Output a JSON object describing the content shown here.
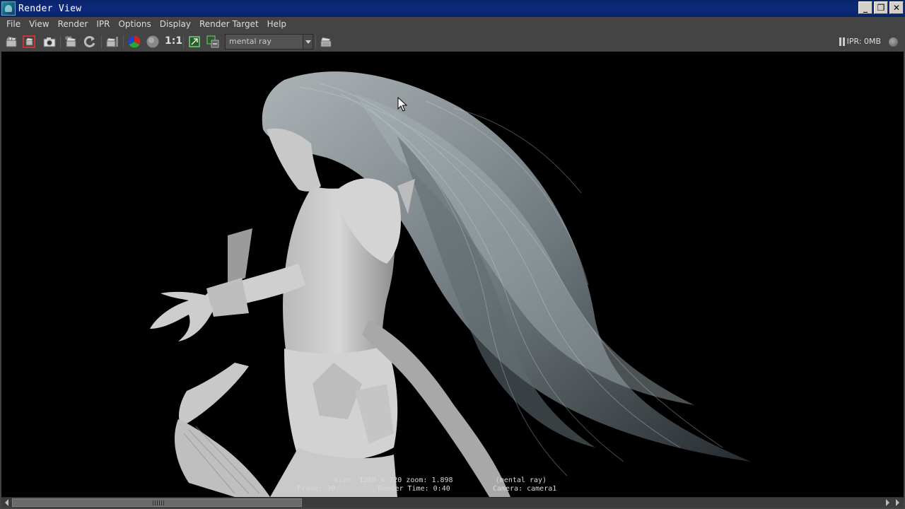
{
  "window": {
    "title": "Render View",
    "minimize": "_",
    "restore": "❐",
    "close": "✕"
  },
  "menu": [
    "File",
    "View",
    "Render",
    "IPR",
    "Options",
    "Display",
    "Render Target",
    "Help"
  ],
  "toolbar": {
    "ratio_label": "1:1",
    "renderer": "mental ray",
    "ipr_status": "IPR: 0MB"
  },
  "render_info": {
    "line1": "size: 1280 x 720 zoom: 1.898          (mental ray)",
    "line2": "Frame: 39          Render Time: 0:40          Camera: camera1"
  },
  "icons": {
    "app": "maya-app-icon",
    "render": "clapboard-icon",
    "render-region": "render-region-icon",
    "snapshot": "camera-snapshot-icon",
    "ipr": "ipr-render-icon",
    "refresh": "refresh-icon",
    "render-seq": "render-sequence-icon",
    "rgb": "rgb-channels-icon",
    "alpha": "alpha-channel-icon",
    "keep-image": "keep-image-icon",
    "remove-image": "remove-image-icon",
    "render-settings": "render-settings-icon"
  }
}
